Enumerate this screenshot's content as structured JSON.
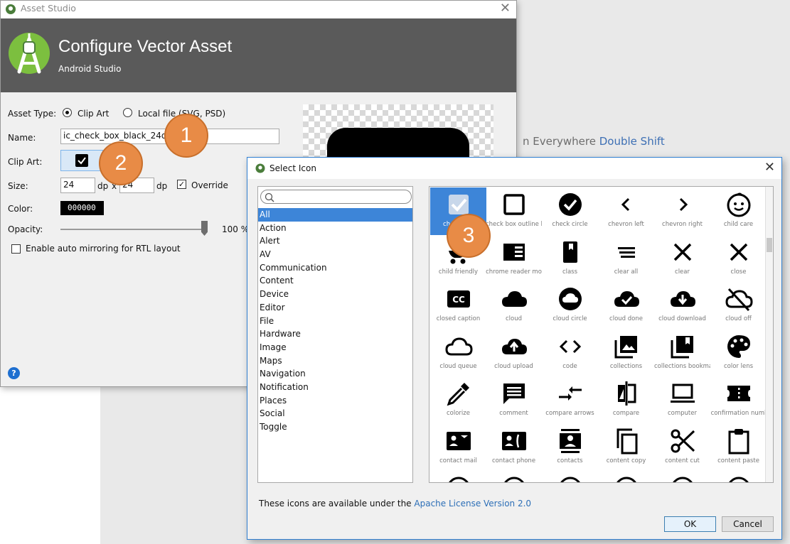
{
  "background": {
    "hint_text": "n Everywhere ",
    "hint_key": "Double Shift"
  },
  "asset_studio": {
    "window_title": "Asset Studio",
    "header_title": "Configure Vector Asset",
    "header_subtitle": "Android Studio",
    "asset_type_label": "Asset Type:",
    "option_clip_art": "Clip Art",
    "option_local_file": "Local file (SVG, PSD)",
    "name_label": "Name:",
    "name_value": "ic_check_box_black_24dp",
    "clip_art_label": "Clip Art:",
    "size_label": "Size:",
    "size_width": "24",
    "size_height": "24",
    "size_unit": "dp",
    "size_x": "x",
    "override_label": "Override",
    "color_label": "Color:",
    "color_value": "000000",
    "opacity_label": "Opacity:",
    "opacity_value": "100 %",
    "rtl_label": "Enable auto mirroring for RTL layout",
    "help_icon": "?"
  },
  "select_icon": {
    "title": "Select Icon",
    "search_placeholder": "",
    "categories": [
      "All",
      "Action",
      "Alert",
      "AV",
      "Communication",
      "Content",
      "Device",
      "Editor",
      "File",
      "Hardware",
      "Image",
      "Maps",
      "Navigation",
      "Notification",
      "Places",
      "Social",
      "Toggle"
    ],
    "selected_category": "All",
    "icons": [
      [
        "check box",
        "check box outline b",
        "check circle",
        "chevron left",
        "chevron right",
        "child care"
      ],
      [
        "child friendly",
        "chrome reader mo",
        "class",
        "clear all",
        "clear",
        "close"
      ],
      [
        "closed caption",
        "cloud",
        "cloud circle",
        "cloud done",
        "cloud download",
        "cloud off"
      ],
      [
        "cloud queue",
        "cloud upload",
        "code",
        "collections",
        "collections bookma",
        "color lens"
      ],
      [
        "colorize",
        "comment",
        "compare arrows",
        "compare",
        "computer",
        "confirmation numl"
      ],
      [
        "contact mail",
        "contact phone",
        "contacts",
        "content copy",
        "content cut",
        "content paste"
      ]
    ],
    "license_text": "These icons are available under the ",
    "license_link": "Apache License Version 2.0",
    "ok_label": "OK",
    "cancel_label": "Cancel"
  },
  "callouts": [
    "1",
    "2",
    "3"
  ],
  "colors": {
    "accent_orange": "#e88b46",
    "selection_blue": "#3d85d8",
    "banner_gray": "#5a5a5a",
    "link_blue": "#2d6fb7"
  }
}
